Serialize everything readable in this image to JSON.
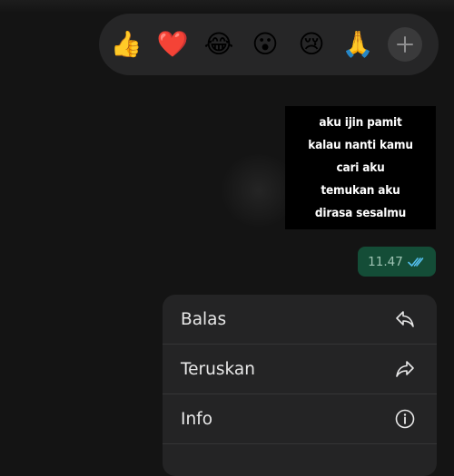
{
  "reactions": {
    "items": [
      {
        "name": "thumbs-up",
        "glyph": "👍"
      },
      {
        "name": "red-heart",
        "glyph": "❤️"
      },
      {
        "name": "tears-of-joy",
        "glyph": "😂"
      },
      {
        "name": "surprised-face",
        "glyph": "😮"
      },
      {
        "name": "crying-face",
        "glyph": "😢"
      },
      {
        "name": "folded-hands",
        "glyph": "🙏"
      }
    ],
    "more_icon": "plus-icon"
  },
  "message": {
    "image_text_lines": [
      "aku ijin pamit",
      "kalau nanti kamu",
      "cari aku",
      "temukan aku",
      "dirasa sesalmu"
    ],
    "time": "11.47",
    "status_icon": "double-check-icon",
    "status_color": "#53bdeb",
    "bubble_color": "#144d37"
  },
  "menu": {
    "items": [
      {
        "label": "Balas",
        "icon": "reply-icon"
      },
      {
        "label": "Teruskan",
        "icon": "forward-icon"
      },
      {
        "label": "Info",
        "icon": "info-icon"
      }
    ]
  }
}
